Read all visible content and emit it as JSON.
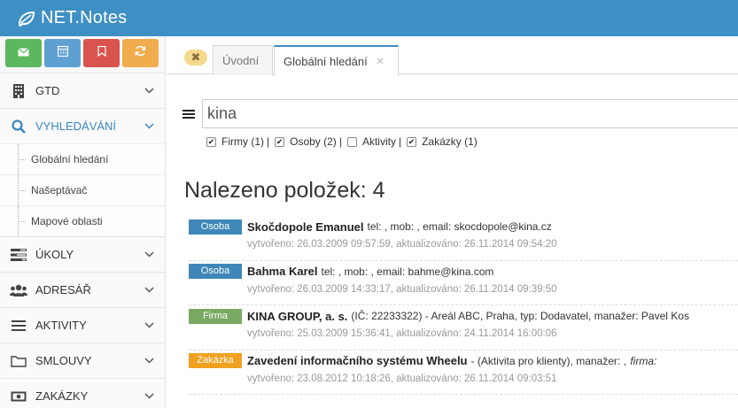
{
  "app": {
    "title": "NET.Notes",
    "logo_icon": "leaf-icon",
    "brand_color": "#3e8fc3"
  },
  "quickbar": [
    {
      "icon": "envelope-icon",
      "color": "#5cb85c"
    },
    {
      "icon": "calendar-icon",
      "color": "#5fa0d3"
    },
    {
      "icon": "bookmark-icon",
      "color": "#d9534f"
    },
    {
      "icon": "refresh-icon",
      "color": "#f0ad4e"
    }
  ],
  "sidebar": {
    "items": [
      {
        "label": "GTD",
        "icon": "building-icon"
      },
      {
        "label": "VYHLEDÁVÁNÍ",
        "icon": "search-icon",
        "active": true,
        "children": [
          {
            "label": "Globální hledání"
          },
          {
            "label": "Našeptávač"
          },
          {
            "label": "Mapové oblasti"
          }
        ]
      },
      {
        "label": "ÚKOLY",
        "icon": "tasks-icon"
      },
      {
        "label": "ADRESÁŘ",
        "icon": "users-icon"
      },
      {
        "label": "AKTIVITY",
        "icon": "list-icon"
      },
      {
        "label": "SMLOUVY",
        "icon": "folder-icon"
      },
      {
        "label": "ZAKÁZKY",
        "icon": "money-icon"
      }
    ]
  },
  "tabs": [
    {
      "label": "Úvodní",
      "active": false
    },
    {
      "label": "Globální hledání",
      "active": true,
      "close": "×"
    }
  ],
  "close_all": "✖",
  "search": {
    "value": "kina"
  },
  "filters": [
    {
      "label": "Firmy (1)",
      "checked": true,
      "sep": "|"
    },
    {
      "label": "Osoby (2)",
      "checked": true,
      "sep": "|"
    },
    {
      "label": "Aktivity",
      "checked": false,
      "sep": "|"
    },
    {
      "label": "Zakázky (1)",
      "checked": true,
      "sep": ""
    }
  ],
  "found_text": "Nalezeno položek: 4",
  "results": [
    {
      "badge": "Osoba",
      "name": "Skočdopole Emanuel",
      "desc": "tel: , mob: , email: skocdopole@kina.cz",
      "desc_italic": "",
      "meta": "vytvořeno: 26.03.2009 09:57:59, aktualizováno: 26.11.2014 09:54:20"
    },
    {
      "badge": "Osoba",
      "name": "Bahma Karel",
      "desc": "tel: , mob: , email: bahme@kina.com",
      "desc_italic": "",
      "meta": "vytvořeno: 26.03.2009 14:33:17, aktualizováno: 26.11.2014 09:39:50"
    },
    {
      "badge": "Firma",
      "name": "KINA GROUP, a. s.",
      "desc": "(IČ: 22233322) - Areál ABC, Praha, typ: Dodavatel, manažer: Pavel Kos",
      "desc_italic": "",
      "meta": "vytvořeno: 25.03.2009 15:36:41, aktualizováno: 24.11.2014 16:00:06"
    },
    {
      "badge": "Zakázka",
      "name": "Zavedení informačního systému Wheelu",
      "desc": "- (Aktivita pro klienty), manažer: ,",
      "desc_italic": "firma:",
      "meta": "vytvořeno: 23.08.2012 10:18:26, aktualizováno: 26.11.2014 09:03:51"
    }
  ]
}
